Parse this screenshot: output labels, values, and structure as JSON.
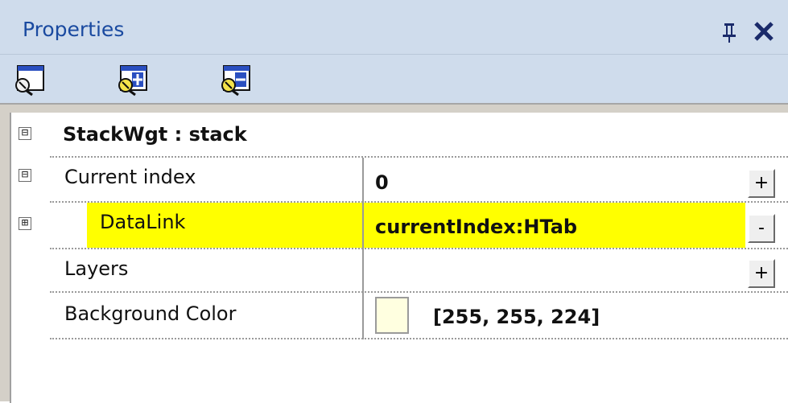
{
  "panel": {
    "title": "Properties",
    "pin_icon": "pin-icon",
    "close_icon": "close-icon"
  },
  "toolbar": {
    "buttons": [
      {
        "name": "properties-view-button",
        "icon": "properties-icon"
      },
      {
        "name": "expand-all-button",
        "icon": "expand-plus-icon"
      },
      {
        "name": "collapse-all-button",
        "icon": "collapse-minus-icon"
      }
    ]
  },
  "grid": {
    "header": "StackWgt : stack",
    "header_expander": "⊟",
    "rows": [
      {
        "label": "Current index",
        "value": "0",
        "expander": "⊟",
        "button": "+"
      },
      {
        "label": "DataLink",
        "value": "currentIndex:HTab",
        "expander": "⊞",
        "button": "-",
        "highlight": "#ffff00"
      },
      {
        "label": "Layers",
        "value": "",
        "button": "+"
      },
      {
        "label": "Background Color",
        "value": "[255, 255, 224]",
        "swatch": "#ffffe0"
      }
    ]
  },
  "colors": {
    "title_bg": "#cfdcec",
    "title_text": "#1a4aa0",
    "highlight": "#ffff00",
    "grid_bg": "#d4d0c8"
  }
}
